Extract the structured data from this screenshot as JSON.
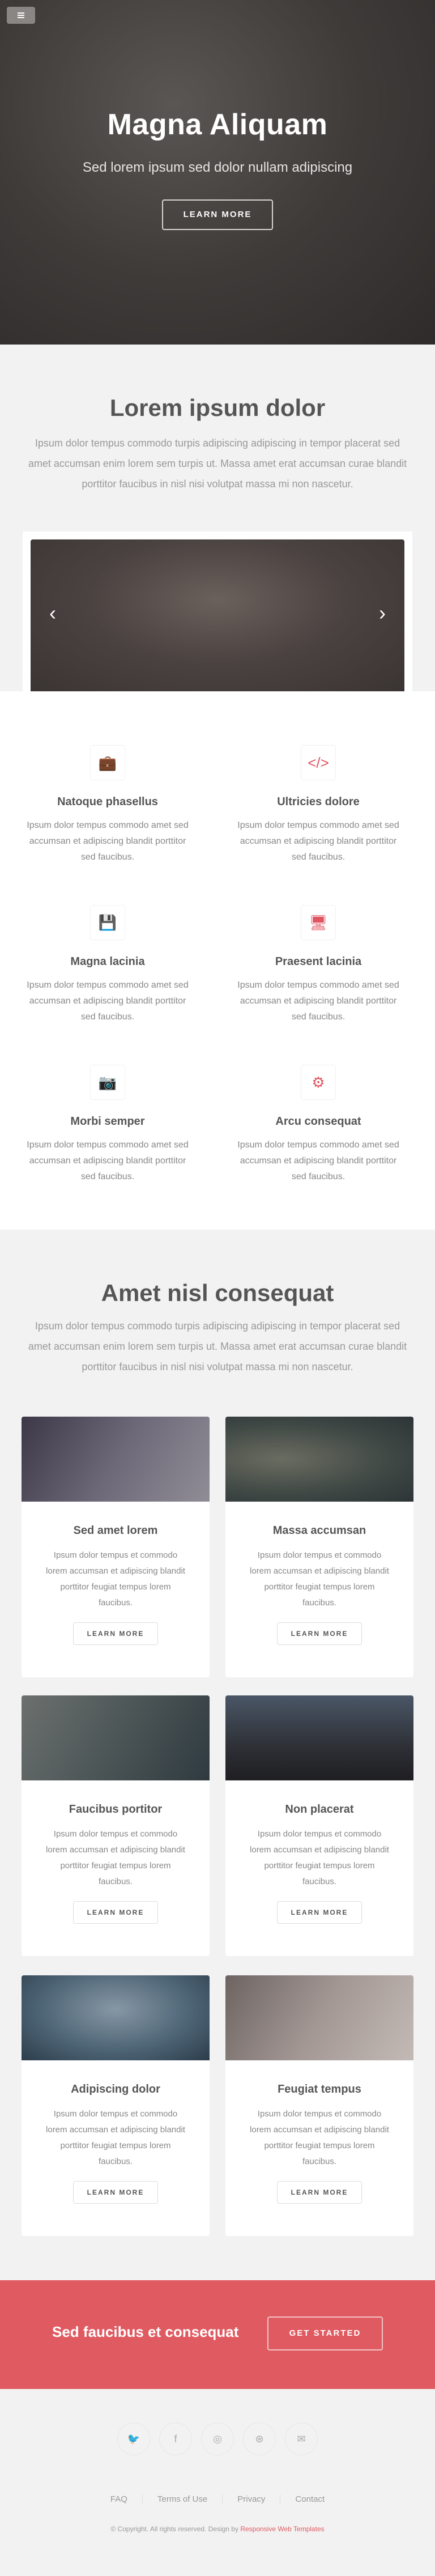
{
  "hero": {
    "title": "Magna Aliquam",
    "subtitle": "Sed lorem ipsum sed dolor nullam adipiscing",
    "button": "LEARN MORE"
  },
  "intro": {
    "title": "Lorem ipsum dolor",
    "text": "Ipsum dolor tempus commodo turpis adipiscing adipiscing in tempor placerat sed amet accumsan enim lorem sem turpis ut. Massa amet erat accumsan curae blandit porttitor faucibus in nisl nisi volutpat massa mi non nascetur.",
    "slider_prev": "‹",
    "slider_next": "›"
  },
  "features": [
    {
      "icon": "briefcase-icon",
      "glyph": "💼",
      "title": "Natoque phasellus",
      "text": "Ipsum dolor tempus commodo amet sed accumsan et adipiscing blandit porttitor sed faucibus."
    },
    {
      "icon": "code-icon",
      "glyph": "</>",
      "title": "Ultricies dolore",
      "text": "Ipsum dolor tempus commodo amet sed accumsan et adipiscing blandit porttitor sed faucibus."
    },
    {
      "icon": "save-icon",
      "glyph": "💾",
      "title": "Magna lacinia",
      "text": "Ipsum dolor tempus commodo amet sed accumsan et adipiscing blandit porttitor sed faucibus."
    },
    {
      "icon": "desktop-icon",
      "glyph": "🖥",
      "title": "Praesent lacinia",
      "text": "Ipsum dolor tempus commodo amet sed accumsan et adipiscing blandit porttitor sed faucibus."
    },
    {
      "icon": "camera-icon",
      "glyph": "📷",
      "title": "Morbi semper",
      "text": "Ipsum dolor tempus commodo amet sed accumsan et adipiscing blandit porttitor sed faucibus."
    },
    {
      "icon": "cog-icon",
      "glyph": "⚙",
      "title": "Arcu consequat",
      "text": "Ipsum dolor tempus commodo amet sed accumsan et adipiscing blandit porttitor sed faucibus."
    }
  ],
  "cards_section": {
    "title": "Amet nisl consequat",
    "text": "Ipsum dolor tempus commodo turpis adipiscing adipiscing in tempor placerat sed amet accumsan enim lorem sem turpis ut. Massa amet erat accumsan curae blandit porttitor faucibus in nisl nisi volutpat massa mi non nascetur.",
    "cards": [
      {
        "title": "Sed amet lorem",
        "text": "Ipsum dolor tempus et commodo lorem accumsan et adipiscing blandit porttitor feugiat tempus lorem faucibus.",
        "button": "LEARN MORE",
        "thumb_color": "#565061"
      },
      {
        "title": "Massa accumsan",
        "text": "Ipsum dolor tempus et commodo lorem accumsan et adipiscing blandit porttitor feugiat tempus lorem faucibus.",
        "button": "LEARN MORE",
        "thumb_color": "#4d5450"
      },
      {
        "title": "Faucibus portitor",
        "text": "Ipsum dolor tempus et commodo lorem accumsan et adipiscing blandit porttitor feugiat tempus lorem faucibus.",
        "button": "LEARN MORE",
        "thumb_color": "#5b6363"
      },
      {
        "title": "Non placerat",
        "text": "Ipsum dolor tempus et commodo lorem accumsan et adipiscing blandit porttitor feugiat tempus lorem faucibus.",
        "button": "LEARN MORE",
        "thumb_color": "#4a4f57"
      },
      {
        "title": "Adipiscing dolor",
        "text": "Ipsum dolor tempus et commodo lorem accumsan et adipiscing blandit porttitor feugiat tempus lorem faucibus.",
        "button": "LEARN MORE",
        "thumb_color": "#5d7080"
      },
      {
        "title": "Feugiat tempus",
        "text": "Ipsum dolor tempus et commodo lorem accumsan et adipiscing blandit porttitor feugiat tempus lorem faucibus.",
        "button": "LEARN MORE",
        "thumb_color": "#8a7e7c"
      }
    ]
  },
  "cta": {
    "title": "Sed faucibus et consequat",
    "button": "GET STARTED"
  },
  "footer": {
    "socials": [
      {
        "icon": "twitter-icon",
        "glyph": "🐦"
      },
      {
        "icon": "facebook-icon",
        "glyph": "f"
      },
      {
        "icon": "instagram-icon",
        "glyph": "◎"
      },
      {
        "icon": "dribbble-icon",
        "glyph": "⊛"
      },
      {
        "icon": "email-icon",
        "glyph": "✉"
      }
    ],
    "links": [
      "FAQ",
      "Terms of Use",
      "Privacy",
      "Contact"
    ],
    "copyright": "© Copyright. All rights reserved. Design by",
    "credit": "Responsive Web Templates"
  },
  "colors": {
    "accent": "#e05a61",
    "hero_bg": "#3f3b39",
    "section_bg": "#f2f2f2"
  }
}
